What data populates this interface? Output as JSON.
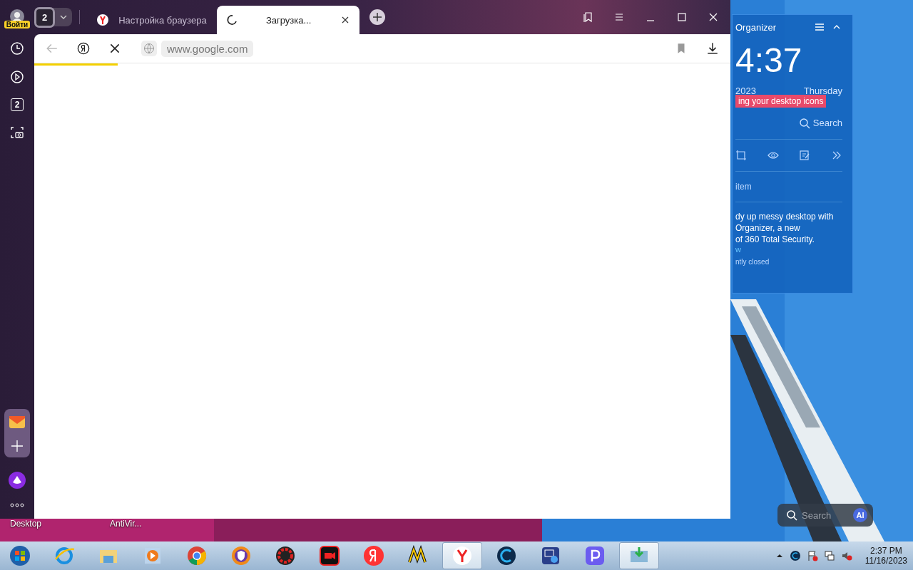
{
  "browser": {
    "profile_label": "Войти",
    "tab_count": "2",
    "tabs": [
      {
        "title": "Настройка браузера",
        "selected": false,
        "loading": false
      },
      {
        "title": "Загрузка...",
        "selected": true,
        "loading": true
      }
    ],
    "address": "www.google.com",
    "load": {
      "level": 0.12
    },
    "sidebar": {
      "tabs_badge": "2"
    }
  },
  "organizer": {
    "title": "Organizer",
    "time": "4:37",
    "date": "2023",
    "weekday": "Thursday",
    "banner": "ing your desktop icons",
    "search": "Search",
    "item": "item",
    "description": [
      "dy up messy desktop with",
      "Organizer, a new",
      "of 360 Total Security."
    ],
    "link": "w",
    "note": "ntly closed"
  },
  "desktop_icons": [
    {
      "label": "Desktop"
    },
    {
      "label": "AntiVir..."
    }
  ],
  "search_widget": {
    "placeholder": "Search",
    "badge": "AI"
  },
  "taskbar": {
    "apps": [
      {
        "kind": "start",
        "selected": false
      },
      {
        "kind": "ie",
        "selected": false
      },
      {
        "kind": "folder",
        "selected": false
      },
      {
        "kind": "media",
        "selected": false
      },
      {
        "kind": "chrome",
        "selected": false
      },
      {
        "kind": "vpn",
        "selected": false
      },
      {
        "kind": "gear",
        "selected": false
      },
      {
        "kind": "recorder",
        "selected": false
      },
      {
        "kind": "yandex",
        "selected": false
      },
      {
        "kind": "market",
        "selected": false
      },
      {
        "kind": "browser",
        "selected": true
      },
      {
        "kind": "ccleaner",
        "selected": false
      },
      {
        "kind": "remote",
        "selected": false
      },
      {
        "kind": "p-app",
        "selected": false
      },
      {
        "kind": "installer",
        "selected": true
      }
    ],
    "time": "2:37 PM",
    "date": "11/16/2023"
  }
}
